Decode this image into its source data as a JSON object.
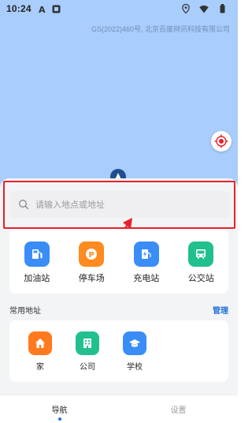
{
  "status_bar": {
    "time": "10:24",
    "left_icons": [
      "font-a-icon",
      "app-square-icon"
    ],
    "right_icons": [
      "location-icon",
      "wifi-icon",
      "battery-icon"
    ]
  },
  "map": {
    "background_color": "#a9cdfc",
    "copyright": "GS(2022)460号, 北京百度网讯科技有限公司"
  },
  "search": {
    "placeholder": "请输入地点或地址"
  },
  "poi_categories": [
    {
      "label": "加油站",
      "icon": "gas-station-icon",
      "color": "#3a8df7"
    },
    {
      "label": "停车场",
      "icon": "parking-icon",
      "color": "#ff8a1f"
    },
    {
      "label": "充电站",
      "icon": "charging-station-icon",
      "color": "#3a8df7"
    },
    {
      "label": "公交站",
      "icon": "bus-stop-icon",
      "color": "#22c08f"
    }
  ],
  "common_addresses": {
    "title": "常用地址",
    "manage_label": "管理",
    "items": [
      {
        "label": "家",
        "icon": "home-icon",
        "color": "#ff7a1f"
      },
      {
        "label": "公司",
        "icon": "office-building-icon",
        "color": "#22c08f"
      },
      {
        "label": "学校",
        "icon": "graduation-cap-icon",
        "color": "#3a8df7"
      }
    ]
  },
  "bottom_nav": {
    "tabs": [
      {
        "label": "导航",
        "active": true
      },
      {
        "label": "设置",
        "active": false
      }
    ]
  },
  "annotation": {
    "highlight_color": "#e8202a"
  }
}
